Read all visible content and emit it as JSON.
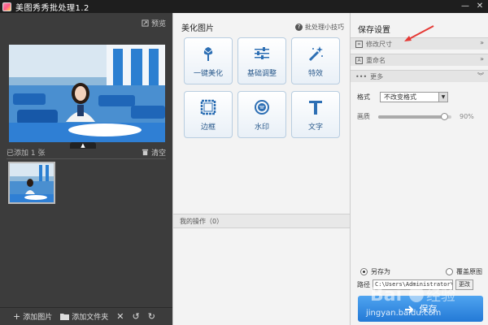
{
  "app": {
    "title": "美图秀秀批处理1.2",
    "window_controls": [
      "—",
      "✕"
    ]
  },
  "left_panel": {
    "preview_label": "预览",
    "added_count_label": "已添加 1 张",
    "clear_label": "清空",
    "bottom_actions": {
      "add_image": "添加图片",
      "add_folder": "添加文件夹"
    }
  },
  "middle_panel": {
    "title": "美化图片",
    "tips_label": "批处理小技巧",
    "tools": [
      {
        "label": "一键美化",
        "icon": "tulip-icon"
      },
      {
        "label": "基础调整",
        "icon": "sliders-icon"
      },
      {
        "label": "特效",
        "icon": "magic-wand-icon"
      },
      {
        "label": "边框",
        "icon": "frame-icon"
      },
      {
        "label": "水印",
        "icon": "watermark-stamp-icon"
      },
      {
        "label": "文字",
        "icon": "text-t-icon"
      }
    ],
    "ops_label": "我的操作（0）"
  },
  "right_panel": {
    "title": "保存设置",
    "sections": {
      "resize": "修改尺寸",
      "rename": "重命名",
      "more": "更多"
    },
    "format_label": "格式",
    "format_value": "不改变格式",
    "quality_label": "画质",
    "quality_value": "90%",
    "quality_fraction": 0.9,
    "save_as_label": "另存为",
    "overwrite_label": "覆盖原图",
    "path_label": "路径",
    "path_value": "C:\\Users\\Administrator\\De",
    "change_label": "更改",
    "save_label": "保存"
  },
  "watermark_site": "jingyan.baidu.com",
  "colors": {
    "accent_blue": "#2379d6",
    "annotation_red": "#e53935"
  }
}
